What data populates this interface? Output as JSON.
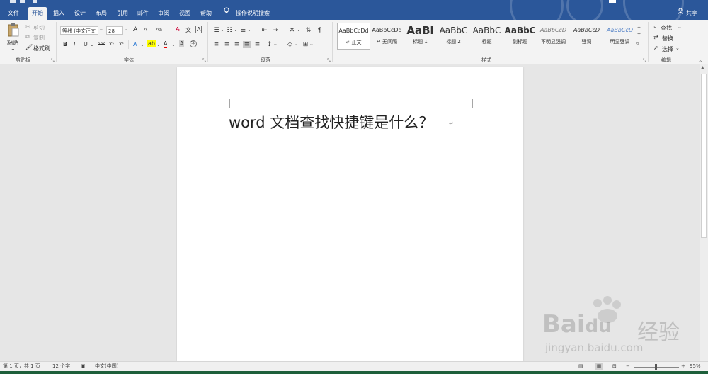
{
  "tabs": [
    "文件",
    "开始",
    "插入",
    "设计",
    "布局",
    "引用",
    "邮件",
    "审阅",
    "视图",
    "帮助"
  ],
  "active_tab": "开始",
  "tell_me": "操作说明搜索",
  "share": "共享",
  "clipboard": {
    "paste": "粘贴",
    "cut": "剪切",
    "copy": "复制",
    "format_painter": "格式刷",
    "label": "剪贴板"
  },
  "font": {
    "name": "等线 (中文正文",
    "size": "28",
    "grow": "A",
    "shrink": "A",
    "case": "Aa",
    "bold": "B",
    "italic": "I",
    "underline": "U",
    "strike": "abc",
    "subscript": "x₂",
    "superscript": "x²",
    "font_color": "A",
    "label": "字体"
  },
  "paragraph": {
    "label": "段落"
  },
  "styles": {
    "label": "样式",
    "items": [
      {
        "preview": "AaBbCcDd",
        "name": "正文"
      },
      {
        "preview": "AaBbCcDd",
        "name": "无间隔"
      },
      {
        "preview": "AaBl",
        "name": "标题 1"
      },
      {
        "preview": "AaBbC",
        "name": "标题 2"
      },
      {
        "preview": "AaBbC",
        "name": "标题"
      },
      {
        "preview": "AaBbC",
        "name": "副标题"
      },
      {
        "preview": "AaBbCcD",
        "name": "不明显强调"
      },
      {
        "preview": "AaBbCcD",
        "name": "强调"
      },
      {
        "preview": "AaBbCcD",
        "name": "明显强调"
      }
    ]
  },
  "editing": {
    "find": "查找",
    "replace": "替换",
    "select": "选择",
    "label": "编辑"
  },
  "document": {
    "text": "word 文档查找快捷键是什么？",
    "para_mark": "↵"
  },
  "status": {
    "page": "第 1 页，共 1 页",
    "words": "12 个字",
    "language": "中文(中国)",
    "zoom": "95%",
    "zoom_minus": "−",
    "zoom_plus": "+"
  },
  "watermark": {
    "brand": "Bai",
    "brand2": "du",
    "suffix": "经验",
    "url": "jingyan.baidu.com"
  },
  "colors": {
    "accent": "#2b579a",
    "ribbon": "#f3f3f3",
    "canvas": "#e6e6e6"
  }
}
